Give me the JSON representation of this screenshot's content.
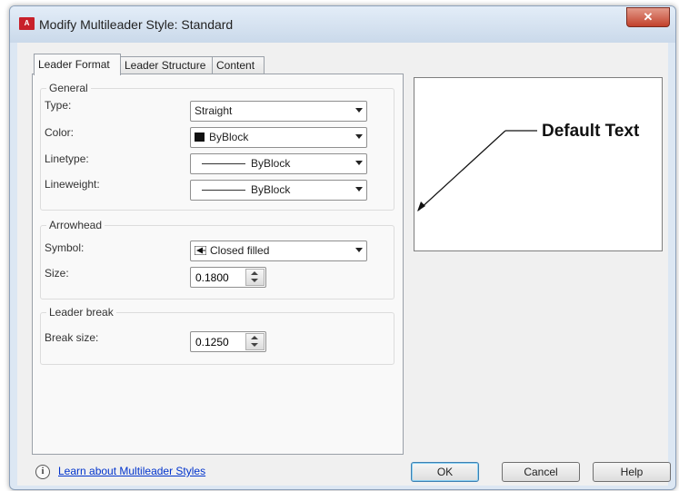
{
  "window": {
    "title": "Modify Multileader Style: Standard",
    "close_label": "✕"
  },
  "tabs": [
    {
      "label": "Leader Format",
      "active": true
    },
    {
      "label": "Leader Structure",
      "active": false
    },
    {
      "label": "Content",
      "active": false
    }
  ],
  "general": {
    "title": "General",
    "type": {
      "label": "Type:",
      "value": "Straight"
    },
    "color": {
      "label": "Color:",
      "value": "ByBlock"
    },
    "linetype": {
      "label": "Linetype:",
      "value": "ByBlock"
    },
    "lineweight": {
      "label": "Lineweight:",
      "value": "ByBlock"
    }
  },
  "arrowhead": {
    "title": "Arrowhead",
    "symbol": {
      "label": "Symbol:",
      "value": "Closed filled"
    },
    "size": {
      "label": "Size:",
      "value": "0.1800"
    }
  },
  "leader_break": {
    "title": "Leader break",
    "break_size": {
      "label": "Break size:",
      "value": "0.1250"
    }
  },
  "preview": {
    "text": "Default Text"
  },
  "footer": {
    "info_icon": "i",
    "link": "Learn about Multileader Styles",
    "ok": "OK",
    "cancel": "Cancel",
    "help": "Help"
  },
  "colors": {
    "link": "#0033cc",
    "close_button": "#c2412b",
    "window_frame": "#dce7f3",
    "app_icon": "#c8202a"
  }
}
